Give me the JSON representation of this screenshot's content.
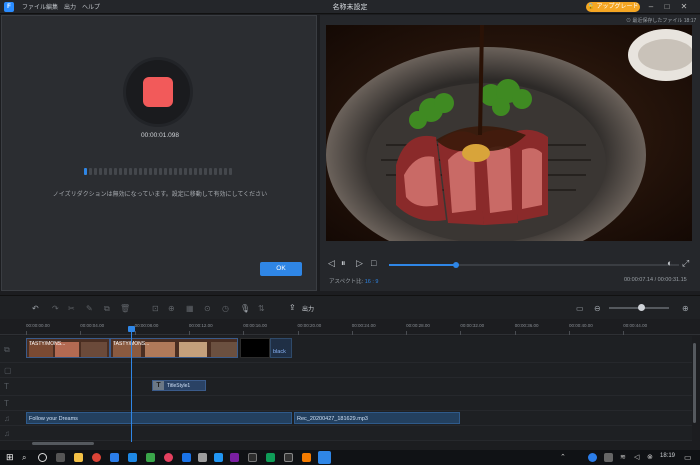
{
  "titlebar": {
    "menus": [
      "ファイル",
      "編集",
      "出力",
      "ヘルプ"
    ],
    "title": "名称未設定",
    "upgrade_label": "🔒 アップグレード",
    "controls": [
      "minimize-icon",
      "maximize-icon",
      "close-icon"
    ]
  },
  "recorder": {
    "elapsed": "00:00:01.098",
    "noise_message": "ノイズリダクションは無効になっています。設定に移動して有効にしてください",
    "ok_label": "OK",
    "stop_color": "#f25a5a"
  },
  "preview": {
    "saved_info": "⊙ 最近保存したファイル 18:17",
    "aspect_label": "アスペクト比:",
    "aspect_value": "16 : 9",
    "time_current": "00:00:07.14",
    "time_total": "00:00:31.15",
    "progress": 0.23
  },
  "toolbar": {
    "export_label": "出力"
  },
  "timeline": {
    "ruler": [
      "00:00:00.00",
      "00:00:04.00",
      "00:00:08.00",
      "00:00:12.00",
      "00:00:16.00",
      "00:00:20.00",
      "00:00:24.00",
      "00:00:28.00",
      "00:00:32.00",
      "00:00:36.00",
      "00:00:40.00",
      "00:00:44.00"
    ],
    "video_clips": [
      {
        "label": "TASTY/MONS..."
      },
      {
        "label": "TASTY/MONS..."
      }
    ],
    "black_clip_label": "black",
    "text_clip_label": "TitleStyle1",
    "audio_clips": [
      {
        "label": "Follow your Dreams"
      },
      {
        "label": "Rec_20200427_181629.mp3"
      }
    ]
  },
  "taskbar": {
    "clock": "18:19"
  },
  "colors": {
    "accent": "#2f86e6",
    "upgrade": "#f5a623",
    "record": "#f25a5a"
  }
}
